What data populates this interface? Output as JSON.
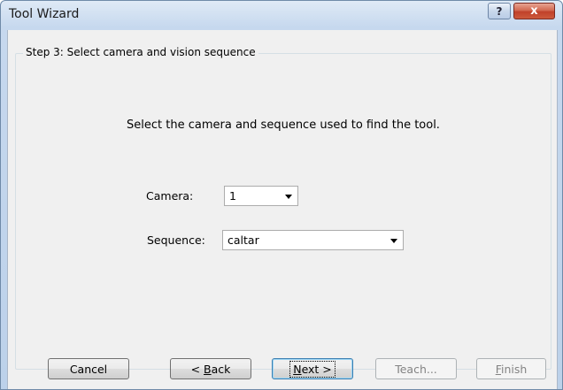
{
  "window": {
    "title": "Tool Wizard",
    "help_label": "?",
    "close_label": "x"
  },
  "step": {
    "title": "Step 3: Select camera and vision sequence",
    "instruction": "Select the camera and sequence used to find the tool."
  },
  "camera": {
    "label": "Camera:",
    "value": "1"
  },
  "sequence": {
    "label": "Sequence:",
    "value": "caltar"
  },
  "buttons": {
    "cancel": "Cancel",
    "back_prefix": "< ",
    "back_hotkey": "B",
    "back_rest": "ack",
    "next_hotkey": "N",
    "next_rest": "ext >",
    "teach": "Teach...",
    "finish_hotkey": "F",
    "finish_rest": "inish"
  },
  "colors": {
    "titlebar": "#c6d8ee",
    "client_bg": "#f0f0f0",
    "close_button": "#c0412a",
    "default_button_border": "#3c7fb1"
  }
}
